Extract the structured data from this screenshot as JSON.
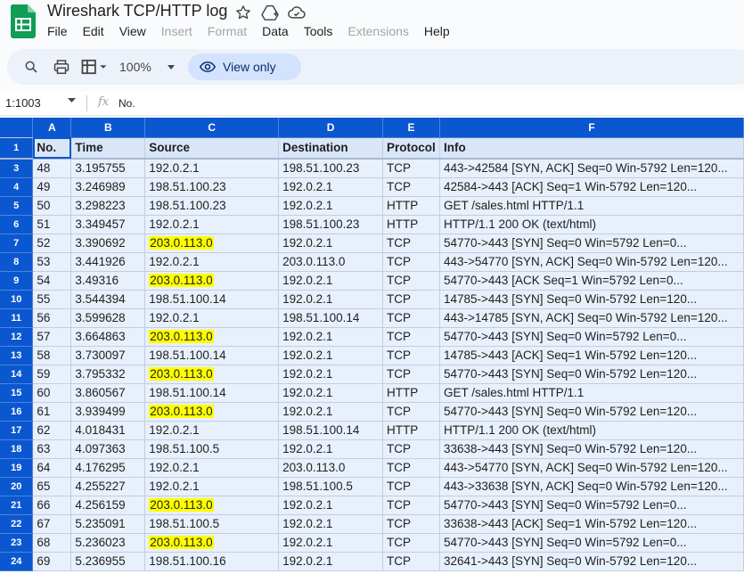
{
  "app": {
    "doc_title": "Wireshark TCP/HTTP log",
    "menu": [
      {
        "label": "File",
        "enabled": true
      },
      {
        "label": "Edit",
        "enabled": true
      },
      {
        "label": "View",
        "enabled": true
      },
      {
        "label": "Insert",
        "enabled": false
      },
      {
        "label": "Format",
        "enabled": false
      },
      {
        "label": "Data",
        "enabled": true
      },
      {
        "label": "Tools",
        "enabled": true
      },
      {
        "label": "Extensions",
        "enabled": false
      },
      {
        "label": "Help",
        "enabled": true
      }
    ],
    "brand_color": "#0f9d58",
    "accent_color": "#0b57d0"
  },
  "toolbar": {
    "zoom": "100%",
    "view_only_label": "View only"
  },
  "formula_bar": {
    "name_box": "1:1003",
    "fx": "fx",
    "value": "No."
  },
  "grid": {
    "column_letters": [
      "A",
      "B",
      "C",
      "D",
      "E",
      "F"
    ],
    "highlight_color": "#ffff00",
    "header_row": {
      "row_number": "1",
      "cells": [
        "No.",
        "Time",
        "Source",
        "Destination",
        "Protocol",
        "Info"
      ]
    },
    "rows": [
      {
        "row_number": "3",
        "cells": [
          "48",
          "3.195755",
          "192.0.2.1",
          "198.51.100.23",
          "TCP",
          "443->42584 [SYN, ACK] Seq=0 Win-5792 Len=120..."
        ],
        "source_highlighted": false
      },
      {
        "row_number": "4",
        "cells": [
          "49",
          "3.246989",
          "198.51.100.23",
          "192.0.2.1",
          "TCP",
          "42584->443 [ACK] Seq=1 Win-5792 Len=120..."
        ],
        "source_highlighted": false
      },
      {
        "row_number": "5",
        "cells": [
          "50",
          "3.298223",
          "198.51.100.23",
          "192.0.2.1",
          "HTTP",
          "GET  /sales.html HTTP/1.1"
        ],
        "source_highlighted": false
      },
      {
        "row_number": "6",
        "cells": [
          "51",
          "3.349457",
          "192.0.2.1",
          "198.51.100.23",
          "HTTP",
          "HTTP/1.1 200 OK (text/html)"
        ],
        "source_highlighted": false
      },
      {
        "row_number": "7",
        "cells": [
          "52",
          "3.390692",
          "203.0.113.0",
          "192.0.2.1",
          "TCP",
          "54770->443 [SYN] Seq=0 Win=5792 Len=0..."
        ],
        "source_highlighted": true
      },
      {
        "row_number": "8",
        "cells": [
          "53",
          "3.441926",
          "192.0.2.1",
          "203.0.113.0",
          "TCP",
          "443->54770 [SYN, ACK] Seq=0 Win-5792 Len=120..."
        ],
        "source_highlighted": false
      },
      {
        "row_number": "9",
        "cells": [
          "54",
          "3.49316",
          "203.0.113.0",
          "192.0.2.1",
          "TCP",
          "54770->443 [ACK Seq=1 Win=5792 Len=0..."
        ],
        "source_highlighted": true
      },
      {
        "row_number": "10",
        "cells": [
          "55",
          "3.544394",
          "198.51.100.14",
          "192.0.2.1",
          "TCP",
          "14785->443 [SYN] Seq=0 Win-5792 Len=120..."
        ],
        "source_highlighted": false
      },
      {
        "row_number": "11",
        "cells": [
          "56",
          "3.599628",
          "192.0.2.1",
          "198.51.100.14",
          "TCP",
          "443->14785 [SYN, ACK] Seq=0 Win-5792 Len=120..."
        ],
        "source_highlighted": false
      },
      {
        "row_number": "12",
        "cells": [
          "57",
          "3.664863",
          "203.0.113.0",
          "192.0.2.1",
          "TCP",
          "54770->443 [SYN] Seq=0 Win=5792 Len=0..."
        ],
        "source_highlighted": true
      },
      {
        "row_number": "13",
        "cells": [
          "58",
          "3.730097",
          "198.51.100.14",
          "192.0.2.1",
          "TCP",
          "14785->443 [ACK] Seq=1 Win-5792 Len=120..."
        ],
        "source_highlighted": false
      },
      {
        "row_number": "14",
        "cells": [
          "59",
          "3.795332",
          "203.0.113.0",
          "192.0.2.1",
          "TCP",
          "54770->443 [SYN] Seq=0 Win-5792 Len=120..."
        ],
        "source_highlighted": true
      },
      {
        "row_number": "15",
        "cells": [
          "60",
          "3.860567",
          "198.51.100.14",
          "192.0.2.1",
          "HTTP",
          "GET  /sales.html HTTP/1.1"
        ],
        "source_highlighted": false
      },
      {
        "row_number": "16",
        "cells": [
          "61",
          "3.939499",
          "203.0.113.0",
          "192.0.2.1",
          "TCP",
          "54770->443 [SYN] Seq=0 Win-5792 Len=120..."
        ],
        "source_highlighted": true
      },
      {
        "row_number": "17",
        "cells": [
          "62",
          "4.018431",
          "192.0.2.1",
          "198.51.100.14",
          "HTTP",
          "HTTP/1.1 200 OK (text/html)"
        ],
        "source_highlighted": false
      },
      {
        "row_number": "18",
        "cells": [
          "63",
          "4.097363",
          "198.51.100.5",
          "192.0.2.1",
          "TCP",
          "33638->443 [SYN] Seq=0 Win-5792 Len=120..."
        ],
        "source_highlighted": false
      },
      {
        "row_number": "19",
        "cells": [
          "64",
          "4.176295",
          "192.0.2.1",
          "203.0.113.0",
          "TCP",
          "443->54770 [SYN, ACK] Seq=0 Win-5792 Len=120..."
        ],
        "source_highlighted": false
      },
      {
        "row_number": "20",
        "cells": [
          "65",
          "4.255227",
          "192.0.2.1",
          "198.51.100.5",
          "TCP",
          "443->33638 [SYN, ACK] Seq=0 Win-5792 Len=120..."
        ],
        "source_highlighted": false
      },
      {
        "row_number": "21",
        "cells": [
          "66",
          "4.256159",
          "203.0.113.0",
          "192.0.2.1",
          "TCP",
          "54770->443 [SYN] Seq=0 Win=5792 Len=0..."
        ],
        "source_highlighted": true
      },
      {
        "row_number": "22",
        "cells": [
          "67",
          "5.235091",
          "198.51.100.5",
          "192.0.2.1",
          "TCP",
          "33638->443 [ACK] Seq=1 Win-5792 Len=120..."
        ],
        "source_highlighted": false
      },
      {
        "row_number": "23",
        "cells": [
          "68",
          "5.236023",
          "203.0.113.0",
          "192.0.2.1",
          "TCP",
          "54770->443 [SYN] Seq=0 Win=5792 Len=0..."
        ],
        "source_highlighted": true
      },
      {
        "row_number": "24",
        "cells": [
          "69",
          "5.236955",
          "198.51.100.16",
          "192.0.2.1",
          "TCP",
          "32641->443 [SYN] Seq=0 Win-5792 Len=120..."
        ],
        "source_highlighted": false
      }
    ]
  }
}
